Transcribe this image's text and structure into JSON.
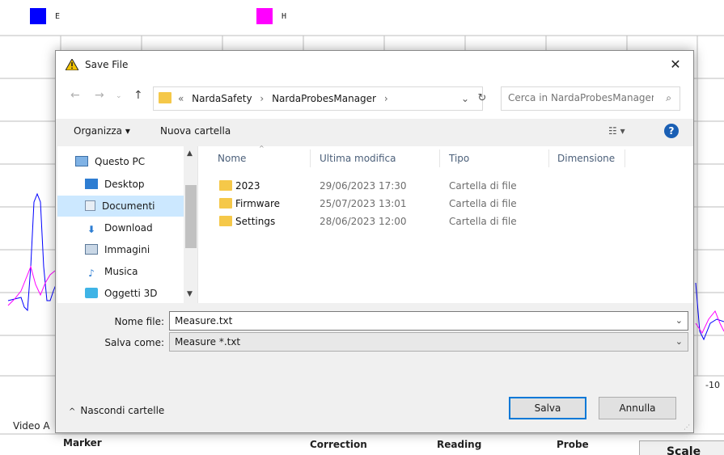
{
  "background": {
    "legend": [
      {
        "label": "E",
        "color": "#0000ff"
      },
      {
        "label": "H",
        "color": "#ff00ff"
      }
    ],
    "axis_label": "-10",
    "video_label": "Video A",
    "bottom_labels": {
      "marker": "Marker",
      "correction": "Correction",
      "reading": "Reading",
      "probe": "Probe"
    },
    "scale_label": "Scale"
  },
  "dialog": {
    "title": "Save File",
    "close_label": "✕",
    "address": {
      "prefix": "«",
      "segments": [
        "NardaSafety",
        "NardaProbesManager"
      ],
      "separator": "›"
    },
    "search_placeholder": "Cerca in NardaProbesManager",
    "toolbar": {
      "organize_label": "Organizza ▾",
      "new_folder_label": "Nuova cartella",
      "help_label": "?"
    },
    "nav_items": [
      {
        "label": "Questo PC",
        "icon": "computer-icon"
      },
      {
        "label": "Desktop",
        "icon": "desktop-icon"
      },
      {
        "label": "Documenti",
        "icon": "documents-icon",
        "selected": true
      },
      {
        "label": "Download",
        "icon": "download-icon"
      },
      {
        "label": "Immagini",
        "icon": "pictures-icon"
      },
      {
        "label": "Musica",
        "icon": "music-icon"
      },
      {
        "label": "Oggetti 3D",
        "icon": "3d-objects-icon"
      }
    ],
    "columns": {
      "name": "Nome",
      "modified": "Ultima modifica",
      "type": "Tipo",
      "size": "Dimensione"
    },
    "files": [
      {
        "name": "2023",
        "modified": "29/06/2023 17:30",
        "type": "Cartella di file"
      },
      {
        "name": "Firmware",
        "modified": "25/07/2023 13:01",
        "type": "Cartella di file"
      },
      {
        "name": "Settings",
        "modified": "28/06/2023 12:00",
        "type": "Cartella di file"
      }
    ],
    "filename_label": "Nome file:",
    "filename_value": "Measure.txt",
    "savetype_label": "Salva come:",
    "savetype_value": "Measure *.txt",
    "hide_folders_label": "Nascondi cartelle",
    "save_label": "Salva",
    "cancel_label": "Annulla"
  }
}
